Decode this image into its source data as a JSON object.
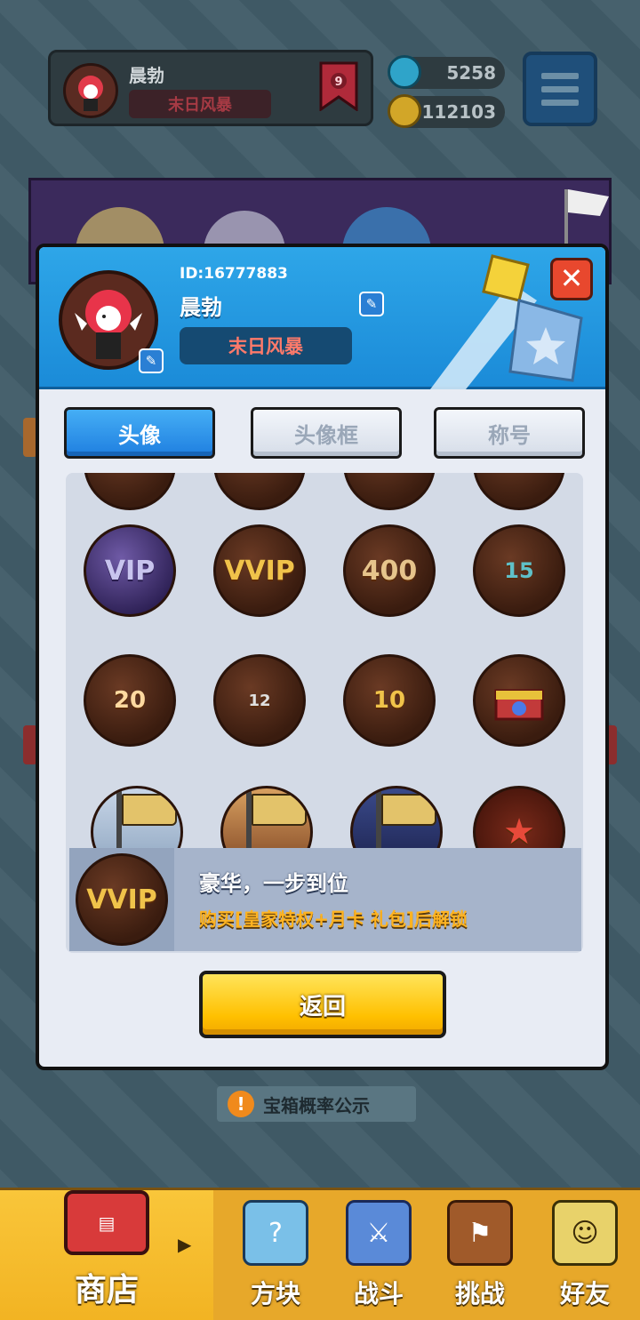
{
  "hud": {
    "player_name": "晨勃",
    "player_title": "末日风暴",
    "rank_level": "9",
    "gems": "5258",
    "gold": "112103"
  },
  "dialog": {
    "id_text": "ID:16777883",
    "name": "晨勃",
    "title": "末日风暴",
    "close_label": "✕",
    "tabs": [
      "头像",
      "头像框",
      "称号"
    ],
    "active_tab": "头像",
    "badges": {
      "row1_partial": [
        "",
        "",
        "",
        ""
      ],
      "row2": [
        "VIP",
        "VVIP",
        "400",
        "15"
      ],
      "row3": [
        "20",
        "12",
        "10",
        ""
      ],
      "row4": [
        "",
        "",
        "",
        ""
      ]
    },
    "selected": {
      "badge": "VVIP",
      "title": "豪华，一步到位",
      "description": "购买[皇家特权+月卡 礼包]后解锁"
    },
    "return_label": "返回"
  },
  "chest_probability": "宝箱概率公示",
  "nav": {
    "items": [
      "商店",
      "方块",
      "战斗",
      "挑战",
      "好友"
    ],
    "active": "商店"
  },
  "colors": {
    "accent_blue": "#1f7fe0",
    "header_blue": "#2ea6e8",
    "title_red": "#ff7a6a",
    "button_yellow": "#ffc000",
    "desc_orange": "#ffb320"
  }
}
